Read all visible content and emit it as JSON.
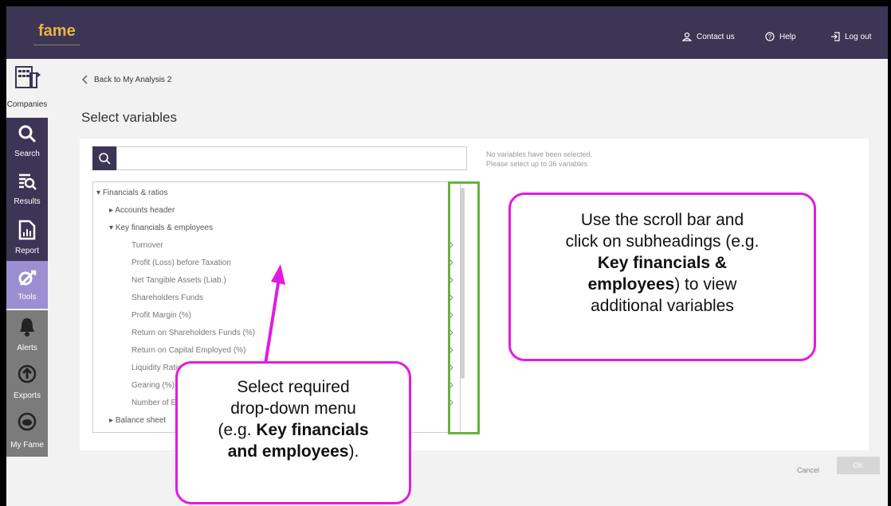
{
  "app": {
    "logo": "fame",
    "nav": {
      "contact": "Contact us",
      "help": "Help",
      "logout": "Log out"
    }
  },
  "sidebar": [
    {
      "key": "companies",
      "label": "Companies",
      "icon": "buildings-icon"
    },
    {
      "key": "search",
      "label": "Search",
      "icon": "search-icon"
    },
    {
      "key": "results",
      "label": "Results",
      "icon": "results-icon"
    },
    {
      "key": "report",
      "label": "Report",
      "icon": "report-icon"
    },
    {
      "key": "tools",
      "label": "Tools",
      "icon": "tools-icon"
    },
    {
      "key": "alerts",
      "label": "Alerts",
      "icon": "bell-icon"
    },
    {
      "key": "exports",
      "label": "Exports",
      "icon": "export-icon"
    },
    {
      "key": "myfame",
      "label": "My Fame",
      "icon": "myfame-icon"
    }
  ],
  "page": {
    "back_label": "Back to My Analysis 2",
    "title": "Select variables",
    "search_placeholder": "",
    "hint_line1": "No variables have been selected.",
    "hint_line2": "Please select up to 36 variables"
  },
  "tree": [
    {
      "label": "Financials & ratios",
      "level": 0,
      "expanded": true
    },
    {
      "label": "Accounts header",
      "level": 1,
      "expanded": false
    },
    {
      "label": "Key financials & employees",
      "level": 1,
      "expanded": true
    },
    {
      "label": "Turnover",
      "level": 2
    },
    {
      "label": "Profit (Loss) before Taxation",
      "level": 2
    },
    {
      "label": "Net Tangible Assets (Liab.)",
      "level": 2
    },
    {
      "label": "Shareholders Funds",
      "level": 2
    },
    {
      "label": "Profit Margin (%)",
      "level": 2
    },
    {
      "label": "Return on Shareholders Funds (%)",
      "level": 2
    },
    {
      "label": "Return on Capital Employed (%)",
      "level": 2
    },
    {
      "label": "Liquidity Ratio",
      "level": 2
    },
    {
      "label": "Gearing (%)",
      "level": 2
    },
    {
      "label": "Number of Employees",
      "level": 2
    },
    {
      "label": "Balance sheet",
      "level": 1,
      "expanded": false
    }
  ],
  "buttons": {
    "cancel": "Cancel",
    "ok": "OK"
  },
  "callouts": {
    "right": {
      "line1": "Use the scroll bar and",
      "line2": "click on subheadings (e.g.",
      "line3_bold": "Key financials &",
      "line4_bold": "employees",
      "line4_rest": ") to view",
      "line5": "additional variables"
    },
    "bottom": {
      "line1": "Select required",
      "line2": "drop-down menu",
      "line3_pre": "(e.g. ",
      "line3_bold": "Key financials",
      "line4_bold": "and employees",
      "line4_rest": ")."
    }
  },
  "colors": {
    "header": "#3d3556",
    "accent": "#e9b53d",
    "callout_border": "#e21be0",
    "scroll_highlight": "#67b23f",
    "tools_bg": "#9b8fd1"
  }
}
